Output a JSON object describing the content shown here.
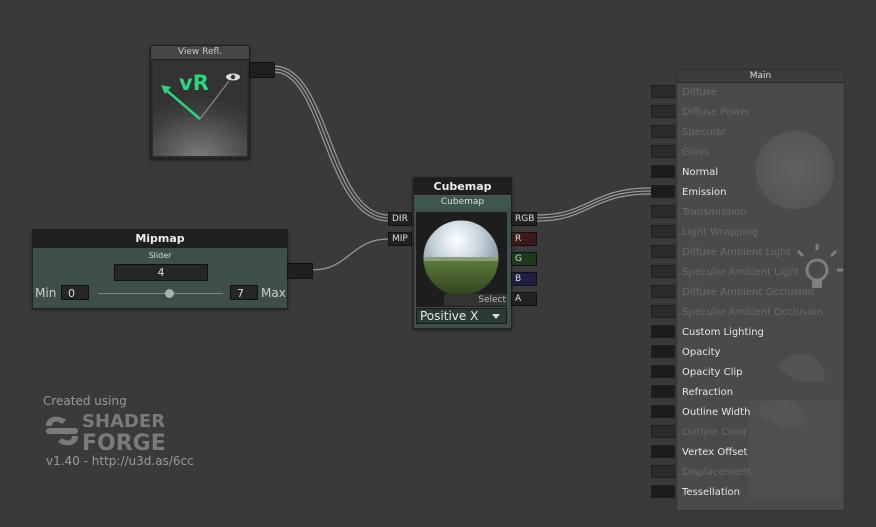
{
  "colors": {
    "canvas_bg": "#3a3a3a",
    "node_green": "#3e4f4a",
    "port_r": "#3a1a1a",
    "port_g": "#1e3a1e",
    "port_b": "#1e1e3f",
    "vr_green": "#2ed47a"
  },
  "view_refl": {
    "title": "View Refl.",
    "glyph": "vR",
    "icons": [
      "arrow-icon",
      "eye-icon"
    ]
  },
  "mipmap": {
    "title": "Mipmap",
    "slider_label": "Slider",
    "value": "4",
    "min_label": "Min",
    "min": "0",
    "max": "7",
    "max_label": "Max",
    "slider_fraction": 0.571
  },
  "cubemap": {
    "title": "Cubemap",
    "subtitle": "Cubemap",
    "select_label": "Select",
    "face": "Positive X",
    "inputs": [
      "DIR",
      "MIP"
    ],
    "outputs": [
      "RGB",
      "R",
      "G",
      "B",
      "A"
    ]
  },
  "main_node": {
    "title": "Main",
    "inputs": [
      {
        "label": "Diffuse",
        "connected": false,
        "enabled": false
      },
      {
        "label": "Diffuse Power",
        "connected": false,
        "enabled": false
      },
      {
        "label": "Specular",
        "connected": false,
        "enabled": false
      },
      {
        "label": "Gloss",
        "connected": false,
        "enabled": false
      },
      {
        "label": "Normal",
        "connected": false,
        "enabled": true
      },
      {
        "label": "Emission",
        "connected": true,
        "enabled": true
      },
      {
        "label": "Transmission",
        "connected": false,
        "enabled": false
      },
      {
        "label": "Light Wrapping",
        "connected": false,
        "enabled": false
      },
      {
        "label": "Diffuse Ambient Light",
        "connected": false,
        "enabled": false
      },
      {
        "label": "Specular Ambient Light",
        "connected": false,
        "enabled": false
      },
      {
        "label": "Diffuse Ambient Occlusion",
        "connected": false,
        "enabled": false
      },
      {
        "label": "Specular Ambient Occlusion",
        "connected": false,
        "enabled": false
      },
      {
        "label": "Custom Lighting",
        "connected": false,
        "enabled": true
      },
      {
        "label": "Opacity",
        "connected": false,
        "enabled": true
      },
      {
        "label": "Opacity Clip",
        "connected": false,
        "enabled": true
      },
      {
        "label": "Refraction",
        "connected": false,
        "enabled": true
      },
      {
        "label": "Outline Width",
        "connected": false,
        "enabled": true
      },
      {
        "label": "Outline Color",
        "connected": false,
        "enabled": false
      },
      {
        "label": "Vertex Offset",
        "connected": false,
        "enabled": true
      },
      {
        "label": "Displacement",
        "connected": false,
        "enabled": false
      },
      {
        "label": "Tessellation",
        "connected": false,
        "enabled": true
      }
    ]
  },
  "credits": {
    "created_using": "Created using",
    "logo_line1": "SHADER",
    "logo_line2": "FORGE",
    "version": "v1.40 - http://u3d.as/6cc"
  }
}
